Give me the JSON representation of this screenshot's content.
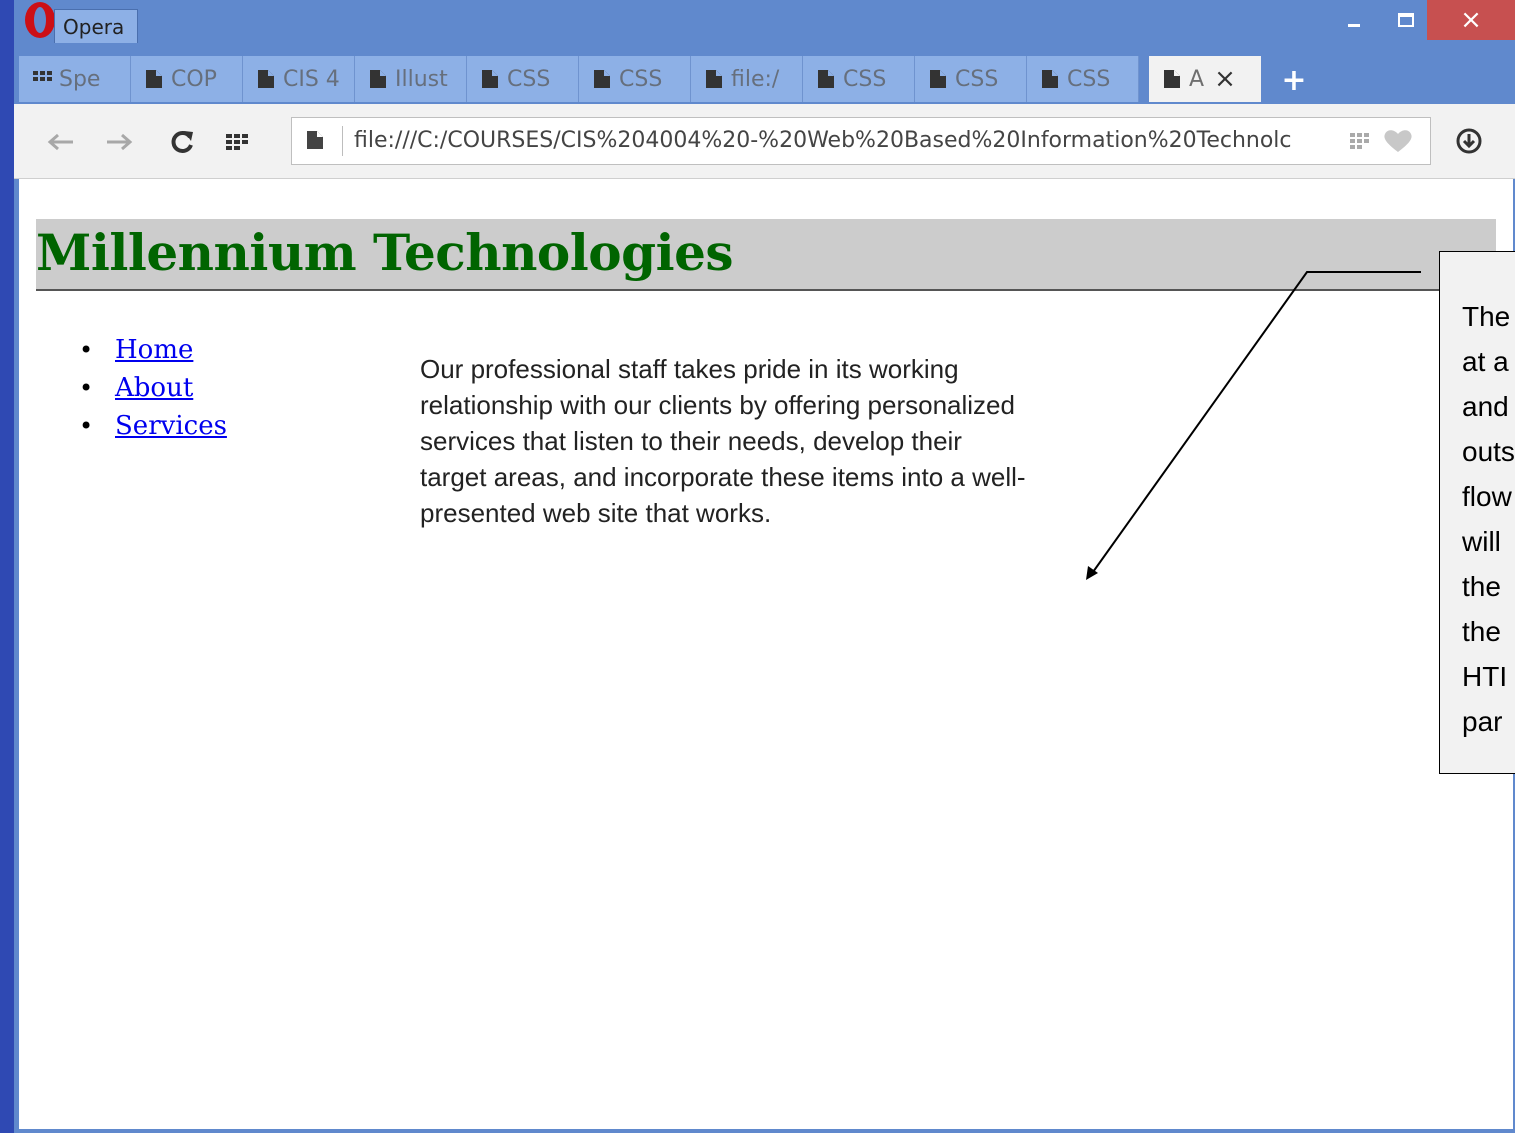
{
  "browser": {
    "app_name": "Opera",
    "tabs": [
      {
        "label": "Spe",
        "icon": "speed-dial-icon"
      },
      {
        "label": "COP",
        "icon": "document-icon"
      },
      {
        "label": "CIS 4",
        "icon": "document-icon"
      },
      {
        "label": "Illust",
        "icon": "document-icon"
      },
      {
        "label": "CSS",
        "icon": "document-icon"
      },
      {
        "label": "CSS",
        "icon": "document-icon"
      },
      {
        "label": "file:/",
        "icon": "document-icon"
      },
      {
        "label": "CSS",
        "icon": "document-icon"
      },
      {
        "label": "CSS",
        "icon": "document-icon"
      },
      {
        "label": "CSS",
        "icon": "document-icon"
      },
      {
        "label": "A",
        "icon": "document-icon",
        "active": true
      }
    ],
    "new_tab_label": "+",
    "close_symbol": "×",
    "address": "file:///C:/COURSES/CIS%204004%20-%20Web%20Based%20Information%20Technolc"
  },
  "page": {
    "title": "Millennium Technologies",
    "nav": [
      "Home",
      "About",
      "Services"
    ],
    "body": "Our professional staff takes pride in its working relationship with our clients by offering personalized services that listen to their needs, develop their target areas, and incorporate these items into a well-presented web site that works."
  },
  "callout": {
    "lines": [
      "The",
      "at a",
      "and",
      "outs",
      "flow",
      "will",
      "the",
      "the",
      "HTI",
      "par"
    ]
  },
  "colors": {
    "title_bar": "#6089cd",
    "tab_inactive": "#8db0e6",
    "close_button": "#c75050",
    "heading_green": "#006400",
    "header_gray": "#cccccc",
    "link_blue": "#0000ee"
  }
}
